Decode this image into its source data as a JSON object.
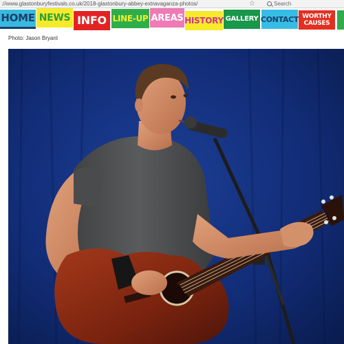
{
  "browser": {
    "url": "://www.glastonburyfestivals.co.uk/2018-glastonbury-abbey-extravaganza-photos/",
    "search_label": "Search"
  },
  "nav": {
    "home": "HOME",
    "news": "NEWS",
    "info": "INFO",
    "lineup": "LINE-UP",
    "areas": "AREAS",
    "history": "HISTORY",
    "gallery": "GALLERY",
    "contact": "CONTACT",
    "worthy_line1": "WORTHY",
    "worthy_line2": "CAUSES"
  },
  "credit": "Photo: Jason Bryant",
  "photo": {
    "subject": "singer-guitarist-performing",
    "background_color": "#0f2a6e",
    "shirt_color": "#4f5052",
    "guitar_color": "#8a2a14"
  }
}
